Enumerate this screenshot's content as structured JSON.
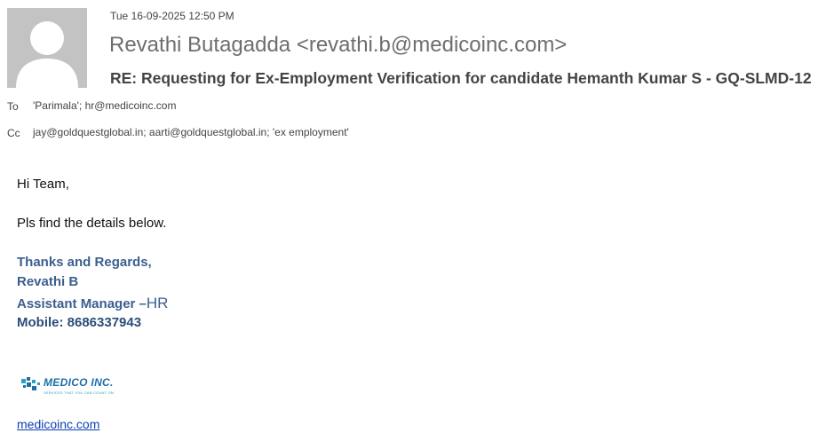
{
  "header": {
    "sent_date": "Tue 16-09-2025 12:50 PM",
    "sender": "Revathi Butagadda <revathi.b@medicoinc.com>",
    "subject": "RE: Requesting for Ex-Employment Verification for candidate Hemanth Kumar S - GQ-SLMD-12"
  },
  "recipients": {
    "to_label": "To",
    "to_value": "'Parimala'; hr@medicoinc.com",
    "cc_label": "Cc",
    "cc_value": "jay@goldquestglobal.in; aarti@goldquestglobal.in; 'ex employment'"
  },
  "body": {
    "greeting": "Hi Team,",
    "details": "Pls find the details below."
  },
  "signature": {
    "thanks": "Thanks and Regards,",
    "name": "Revathi B",
    "title": "Assistant Manager –",
    "title_dept": "HR",
    "mobile": "Mobile: 8686337943"
  },
  "logo": {
    "name": "MEDICO INC.",
    "tagline": "SERVICES THAT YOU CAN COUNT ON"
  },
  "link": {
    "text": "medicoinc.com"
  },
  "colors": {
    "signature": "#3b5f8e",
    "link": "#0b3fb3",
    "logo": "#1d6fa8",
    "avatar_bg": "#c3c3c3"
  }
}
